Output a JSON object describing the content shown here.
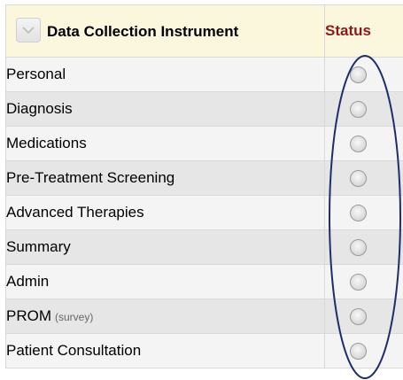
{
  "table": {
    "header": {
      "instrument_label": "Data Collection Instrument",
      "status_label": "Status"
    },
    "rows": [
      {
        "name": "Personal",
        "sub": ""
      },
      {
        "name": "Diagnosis",
        "sub": ""
      },
      {
        "name": "Medications",
        "sub": ""
      },
      {
        "name": "Pre-Treatment Screening",
        "sub": ""
      },
      {
        "name": "Advanced Therapies",
        "sub": ""
      },
      {
        "name": "Summary",
        "sub": ""
      },
      {
        "name": "Admin",
        "sub": ""
      },
      {
        "name": "PROM",
        "sub": "(survey)"
      },
      {
        "name": "Patient Consultation",
        "sub": ""
      }
    ]
  },
  "icons": {
    "collapse": "chevron-down-icon",
    "status": "status-circle-icon"
  },
  "colors": {
    "header_bg": "#fbf7dd",
    "status_header": "#8b1a1a",
    "annotation_ellipse": "#1f2d6b"
  }
}
